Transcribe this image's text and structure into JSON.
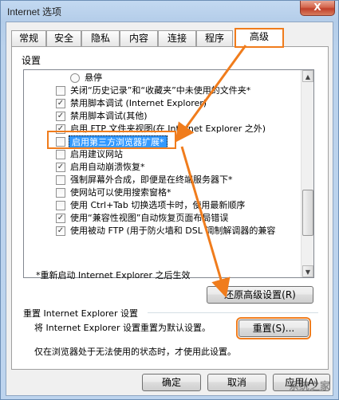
{
  "window": {
    "title": "Internet 选项",
    "close_label": "X"
  },
  "tabs": [
    {
      "label": "常规"
    },
    {
      "label": "安全"
    },
    {
      "label": "隐私"
    },
    {
      "label": "内容"
    },
    {
      "label": "连接"
    },
    {
      "label": "程序"
    },
    {
      "label": "高级"
    }
  ],
  "settings_label": "设置",
  "list": {
    "radio_item": "悬停",
    "items": [
      {
        "label": "关闭“历史记录”和“收藏夹”中未使用的文件夹*",
        "checked": false
      },
      {
        "label": "禁用脚本调试 (Internet Explorer)",
        "checked": true
      },
      {
        "label": "禁用脚本调试(其他)",
        "checked": true
      },
      {
        "label": "启用 FTP 文件夹视图(在 Internet Explorer 之外)",
        "checked": true
      },
      {
        "label": "启用第三方浏览器扩展*",
        "checked": false
      },
      {
        "label": "启用建议网站",
        "checked": false
      },
      {
        "label": "启用自动崩溃恢复*",
        "checked": true
      },
      {
        "label": "强制屏幕外合成，即便是在终端服务器下*",
        "checked": false
      },
      {
        "label": "使网站可以使用搜索窗格*",
        "checked": false
      },
      {
        "label": "使用 Ctrl+Tab 切换选项卡时，使用最新顺序",
        "checked": false
      },
      {
        "label": "使用“兼容性视图”自动恢复页面布局错误",
        "checked": true
      },
      {
        "label": "使用被动 FTP (用于防火墙和 DSL 调制解调器的兼容",
        "checked": true
      }
    ]
  },
  "restart_note": "*重新启动 Internet Explorer 之后生效",
  "restore_button": "还原高级设置(R)",
  "reset_group_title": "重置 Internet Explorer 设置",
  "reset_desc": "将 Internet Explorer 设置重置为默认设置。",
  "reset_button": "重置(S)...",
  "reset_warning": "仅在浏览器处于无法使用的状态时，才使用此设置。",
  "footer": {
    "ok": "确定",
    "cancel": "取消",
    "apply": "应用(A)"
  },
  "watermark": "系统之家",
  "colors": {
    "annotation": "#f07c1c",
    "selection": "#3399ff"
  }
}
